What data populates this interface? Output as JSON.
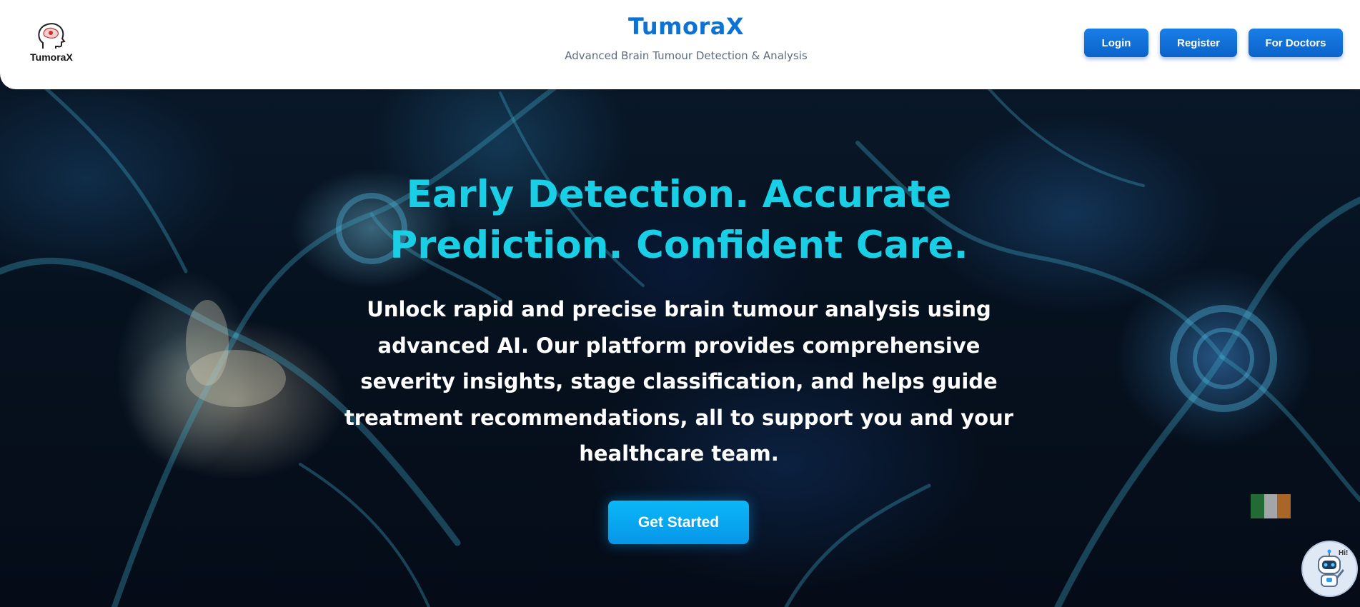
{
  "header": {
    "logo_text": "TumoraX",
    "brand": "TumoraX",
    "tagline": "Advanced Brain Tumour Detection & Analysis",
    "buttons": {
      "login": "Login",
      "register": "Register",
      "for_doctors": "For Doctors"
    }
  },
  "hero": {
    "title": "Early Detection. Accurate Prediction. Confident Care.",
    "body": "Unlock rapid and precise brain tumour analysis using advanced AI. Our platform provides comprehensive severity insights, stage classification, and helps guide treatment recommendations, all to support you and your healthcare team.",
    "cta": "Get Started"
  },
  "chatbot": {
    "badge": "Hi!"
  },
  "colors": {
    "brand": "#0b73d6",
    "nav_button": "#0a63c9",
    "hero_title": "#19cfe6",
    "cta": "#0ab8f7"
  },
  "icons": {
    "logo": "brain-head-icon",
    "chatbot": "robot-icon"
  }
}
